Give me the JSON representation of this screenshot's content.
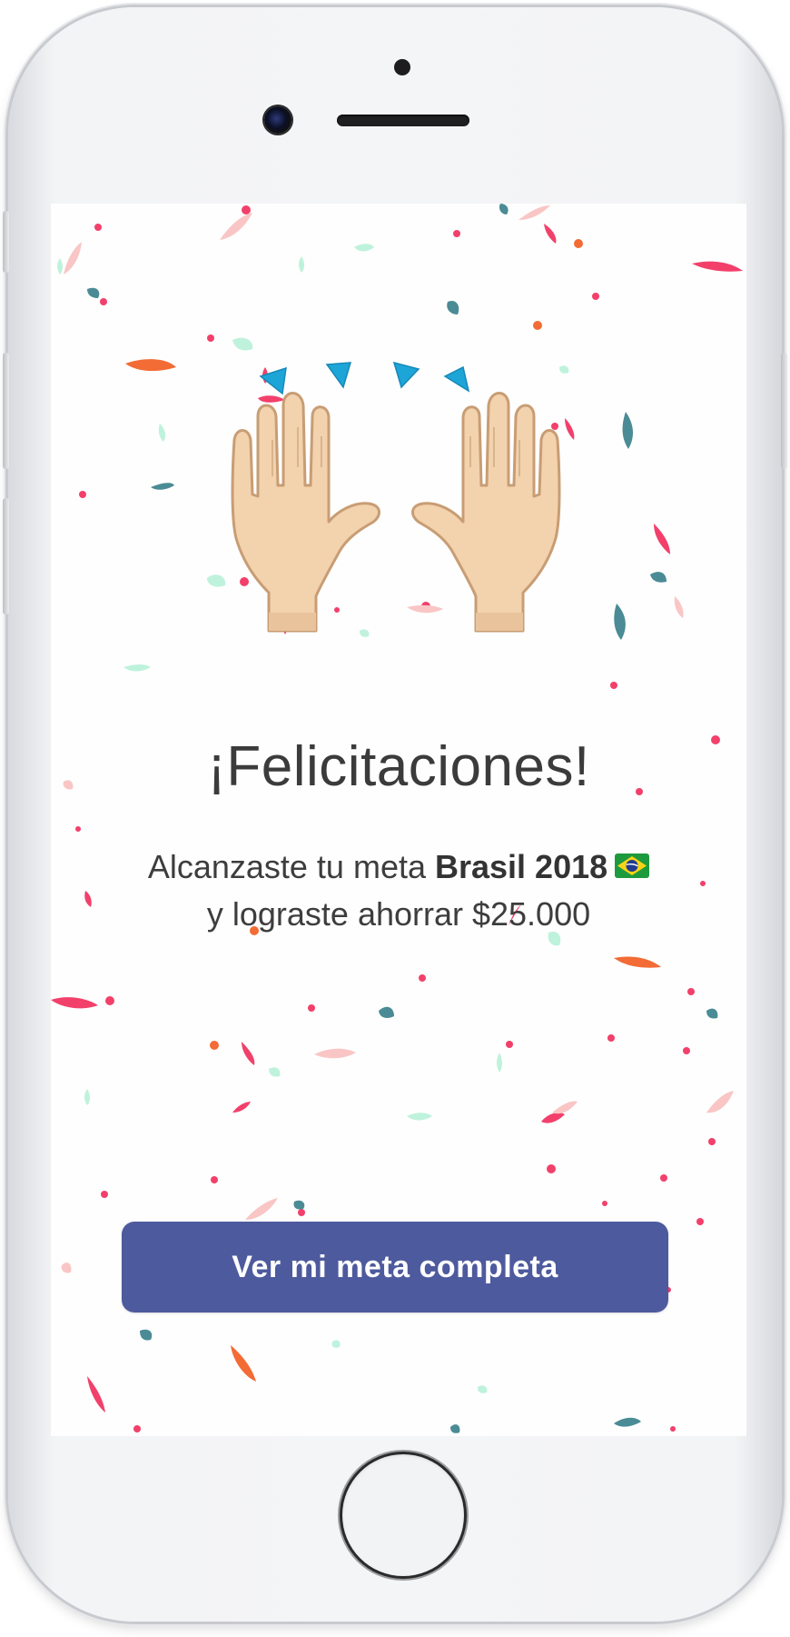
{
  "device": {
    "frame": "iPhone white",
    "icons": {
      "camera": "front-camera-icon",
      "speaker": "earpiece-speaker-icon",
      "home": "home-button-icon"
    }
  },
  "screen": {
    "illustration": "raising-hands-icon",
    "title": "¡Felicitaciones!",
    "message": {
      "prefix": "Alcanzaste tu meta ",
      "goal_name": "Brasil 2018",
      "goal_flag": "brazil-flag-icon",
      "line2": "y lograste ahorrar $25.000"
    },
    "button": {
      "label": "Ver mi meta completa"
    }
  },
  "colors": {
    "button": "#4e5a9e",
    "title_text": "#3b3b3b",
    "confetti": [
      "#f2406b",
      "#f36b35",
      "#4a8b95",
      "#bff2dc",
      "#f9c6c5"
    ],
    "hands_accent": "#1ea5d8"
  }
}
